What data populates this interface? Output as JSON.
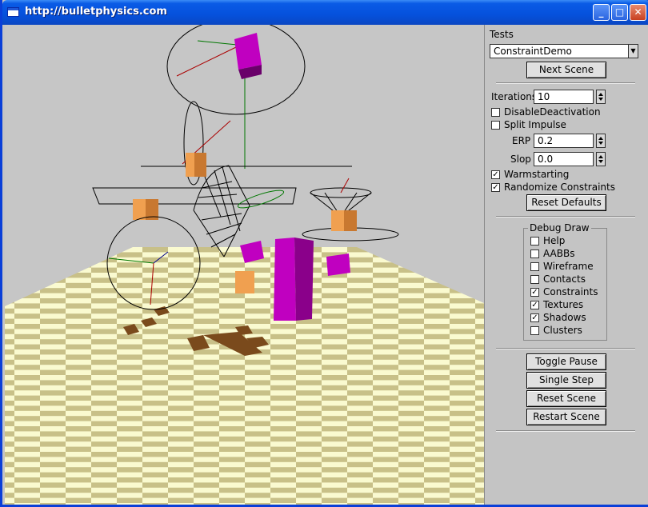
{
  "window": {
    "title": "http://bulletphysics.com",
    "minimize": "_",
    "maximize": "□",
    "close": "✕"
  },
  "panel": {
    "tests_label": "Tests",
    "test_selected": "ConstraintDemo",
    "next_scene": "Next Scene",
    "iterations_label": "Iterations",
    "iterations_value": "10",
    "disable_deactivation": {
      "label": "DisableDeactivation",
      "checked": ""
    },
    "split_impulse": {
      "label": "Split Impulse",
      "checked": ""
    },
    "erp_label": "ERP",
    "erp_value": "0.2",
    "slop_label": "Slop",
    "slop_value": "0.0",
    "warmstarting": {
      "label": "Warmstarting",
      "checked": "✓"
    },
    "randomize_constraints": {
      "label": "Randomize Constraints",
      "checked": "✓"
    },
    "reset_defaults": "Reset Defaults",
    "debug_draw": {
      "title": "Debug Draw",
      "items": [
        {
          "label": "Help",
          "checked": ""
        },
        {
          "label": "AABBs",
          "checked": ""
        },
        {
          "label": "Wireframe",
          "checked": ""
        },
        {
          "label": "Contacts",
          "checked": ""
        },
        {
          "label": "Constraints",
          "checked": "✓"
        },
        {
          "label": "Textures",
          "checked": "✓"
        },
        {
          "label": "Shadows",
          "checked": "✓"
        },
        {
          "label": "Clusters",
          "checked": ""
        }
      ]
    },
    "toggle_pause": "Toggle Pause",
    "single_step": "Single Step",
    "reset_scene": "Reset Scene",
    "restart_scene": "Restart Scene"
  },
  "colors": {
    "magenta": "#c000c0",
    "orange": "#f0a050",
    "floor_light": "#fafad0",
    "floor_dark": "#c8c088"
  }
}
